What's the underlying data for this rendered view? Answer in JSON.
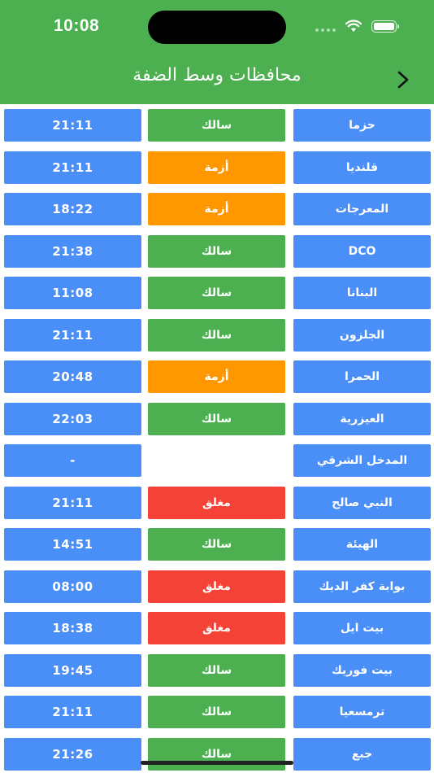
{
  "status_bar": {
    "time": "10:08"
  },
  "nav": {
    "title": "محافظات وسط الضفة"
  },
  "colors": {
    "header": "#4caf50",
    "blue": "#4a8ff7",
    "green": "#4caf50",
    "orange": "#ff9800",
    "red": "#f44336"
  },
  "checkpoints": [
    {
      "name": "حزما",
      "status": "سالك",
      "state": "open",
      "time": "21:11"
    },
    {
      "name": "قلنديا",
      "status": "أزمة",
      "state": "jam",
      "time": "21:11"
    },
    {
      "name": "المعرجات",
      "status": "أزمة",
      "state": "jam",
      "time": "18:22"
    },
    {
      "name": "DCO",
      "status": "سالك",
      "state": "open",
      "time": "21:38"
    },
    {
      "name": "البنانا",
      "status": "سالك",
      "state": "open",
      "time": "11:08"
    },
    {
      "name": "الجلزون",
      "status": "سالك",
      "state": "open",
      "time": "21:11"
    },
    {
      "name": "الحمرا",
      "status": "أزمة",
      "state": "jam",
      "time": "20:48"
    },
    {
      "name": "العيزرية",
      "status": "سالك",
      "state": "open",
      "time": "22:03"
    },
    {
      "name": "المدخل الشرقي",
      "status": "",
      "state": "none",
      "time": "-"
    },
    {
      "name": "النبي صالح",
      "status": "مغلق",
      "state": "closed",
      "time": "21:11"
    },
    {
      "name": "الهيئة",
      "status": "سالك",
      "state": "open",
      "time": "14:51"
    },
    {
      "name": "بوابة كفر الديك",
      "status": "مغلق",
      "state": "closed",
      "time": "08:00"
    },
    {
      "name": "بيت ايل",
      "status": "مغلق",
      "state": "closed",
      "time": "18:38"
    },
    {
      "name": "بيت فوريك",
      "status": "سالك",
      "state": "open",
      "time": "19:45"
    },
    {
      "name": "ترمسعيا",
      "status": "سالك",
      "state": "open",
      "time": "21:11"
    },
    {
      "name": "جبع",
      "status": "سالك",
      "state": "open",
      "time": "21:26"
    }
  ]
}
